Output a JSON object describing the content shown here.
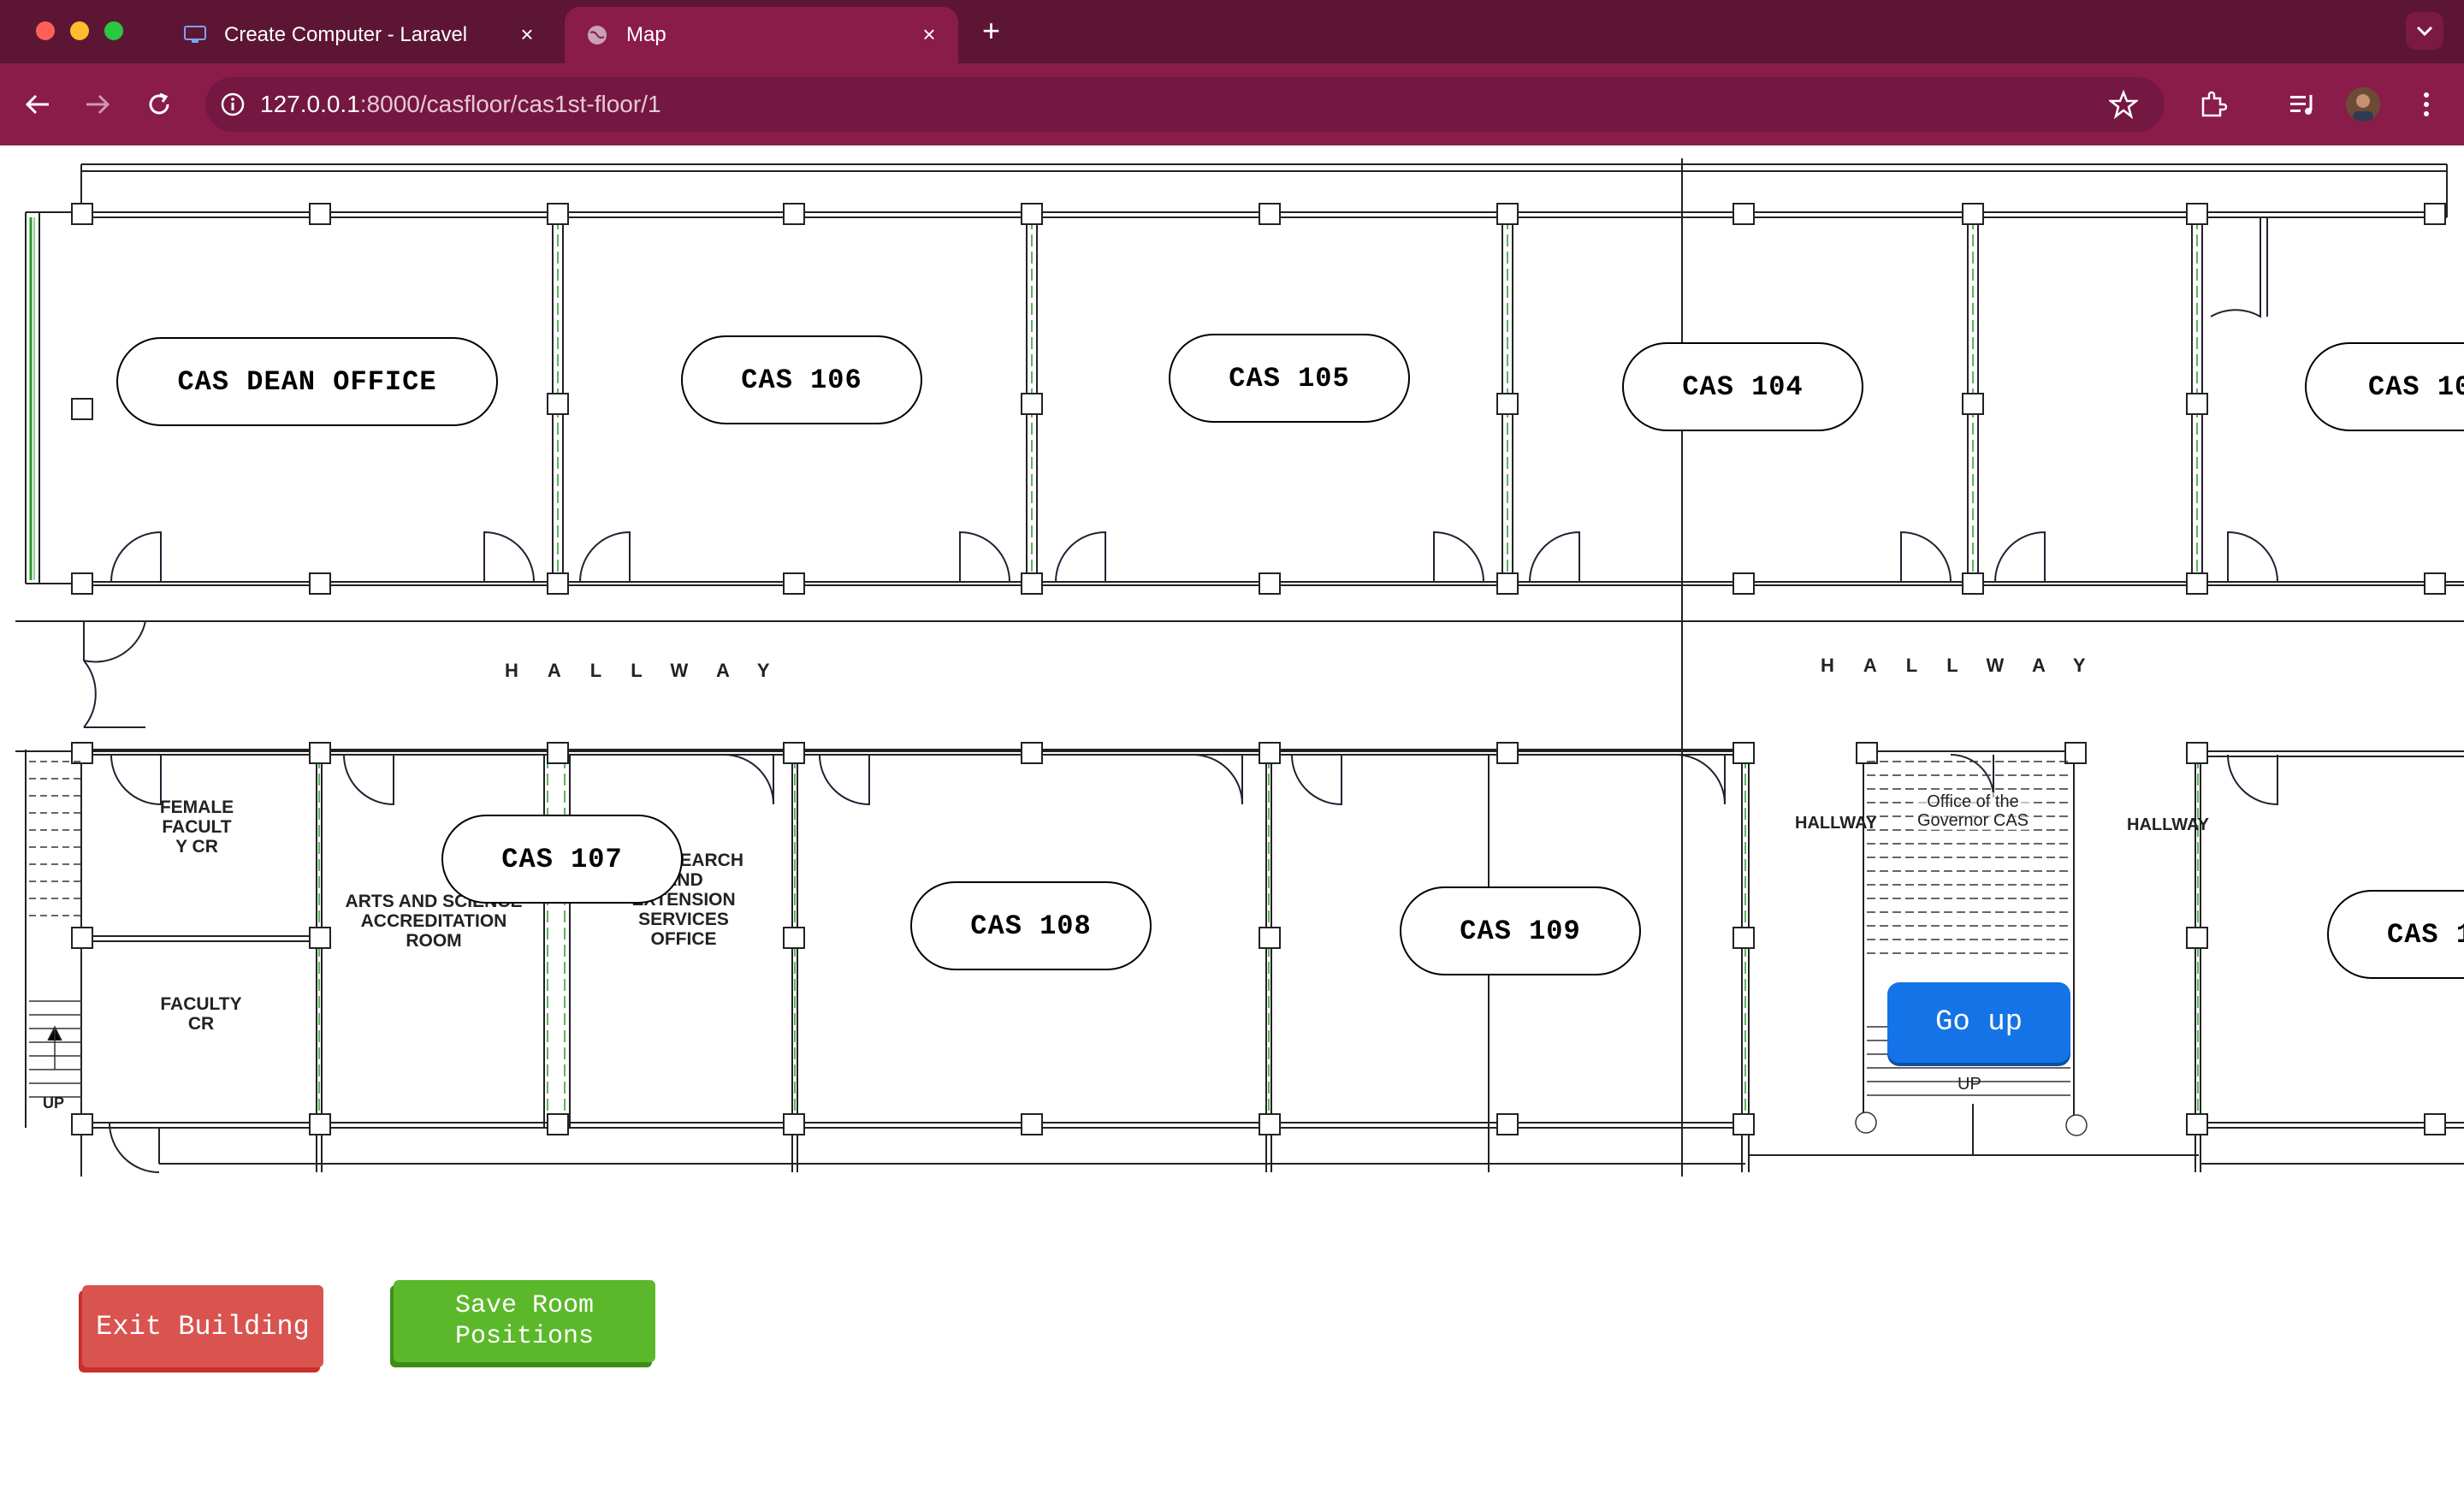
{
  "browser": {
    "tabs": [
      {
        "title": "Create Computer - Laravel",
        "active": false
      },
      {
        "title": "Map",
        "active": true
      }
    ],
    "url_host": "127.0.0.1",
    "url_path": ":8000/casfloor/cas1st-floor/1"
  },
  "rooms": {
    "dean": "CAS DEAN OFFICE",
    "r106": "CAS 106",
    "r105": "CAS 105",
    "r104": "CAS 104",
    "r10x": "CAS 10",
    "r107": "CAS 107",
    "r108": "CAS 108",
    "r109": "CAS 109",
    "r1x": "CAS 1"
  },
  "plan": {
    "hallway": "HALLWAY",
    "female_cr": "FEMALE FACULT Y CR",
    "faculty_cr": "FACULTY CR",
    "accreditation": "ARTS AND SCIENCE ACCREDITATION ROOM",
    "research": "ANCE EARCH AND EXTENSION SERVICES OFFICE",
    "governor": "Office of the Governor CAS",
    "up": "UP"
  },
  "buttons": {
    "go_up": "Go up",
    "exit": "Exit Building",
    "save": "Save Room Positions"
  }
}
